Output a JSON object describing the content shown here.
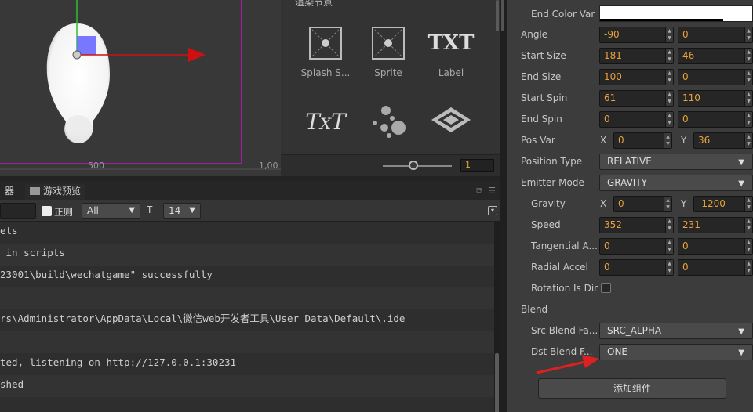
{
  "scene": {
    "ruler_500": "500",
    "ruler_1000": "1,00"
  },
  "nodes": {
    "header": "渲染节点",
    "items": [
      {
        "label": "Splash S...",
        "icon": "splash-sprite-icon"
      },
      {
        "label": "Sprite",
        "icon": "sprite-icon"
      },
      {
        "label": "Label",
        "icon": "label-txt-icon"
      },
      {
        "label": "",
        "icon": "richtext-icon"
      },
      {
        "label": "",
        "icon": "particle-icon"
      },
      {
        "label": "",
        "icon": "tiledmap-icon"
      }
    ],
    "zoom_value": "1"
  },
  "console": {
    "tabs": [
      {
        "label": "器"
      },
      {
        "label": "游戏预览",
        "icon": "game-preview-icon"
      }
    ],
    "toolbar": {
      "regex_label": "正则",
      "level_select": "All",
      "font_size_select": "14"
    },
    "logs": [
      "ets",
      " in scripts",
      "23001\\build\\wechatgame\" successfully",
      "",
      "rs\\Administrator\\AppData\\Local\\微信web开发者工具\\User Data\\Default\\.ide",
      "",
      "ted, listening on http://127.0.0.1:30231",
      "shed",
      ""
    ]
  },
  "inspector": {
    "end_color_var": {
      "label": "End Color Var",
      "color": "#ffffff"
    },
    "angle": {
      "label": "Angle",
      "v1": "-90",
      "v2": "0"
    },
    "start_size": {
      "label": "Start Size",
      "v1": "181",
      "v2": "46"
    },
    "end_size": {
      "label": "End Size",
      "v1": "100",
      "v2": "0"
    },
    "start_spin": {
      "label": "Start Spin",
      "v1": "61",
      "v2": "110"
    },
    "end_spin": {
      "label": "End Spin",
      "v1": "0",
      "v2": "0"
    },
    "pos_var": {
      "label": "Pos Var",
      "x_label": "X",
      "x": "0",
      "y_label": "Y",
      "y": "36"
    },
    "position_type": {
      "label": "Position Type",
      "value": "RELATIVE"
    },
    "emitter_mode": {
      "label": "Emitter Mode",
      "value": "GRAVITY"
    },
    "gravity": {
      "label": "Gravity",
      "x_label": "X",
      "x": "0",
      "y_label": "Y",
      "y": "-1200"
    },
    "speed": {
      "label": "Speed",
      "v1": "352",
      "v2": "231"
    },
    "tangential_accel": {
      "label": "Tangential A...",
      "v1": "0",
      "v2": "0"
    },
    "radial_accel": {
      "label": "Radial Accel",
      "v1": "0",
      "v2": "0"
    },
    "rotation_is_dir": {
      "label": "Rotation Is Dir",
      "checked": false
    },
    "blend": {
      "label": "Blend"
    },
    "src_blend": {
      "label": "Src Blend Fa...",
      "value": "SRC_ALPHA"
    },
    "dst_blend": {
      "label": "Dst Blend F...",
      "value": "ONE"
    },
    "add_component": "添加组件"
  }
}
